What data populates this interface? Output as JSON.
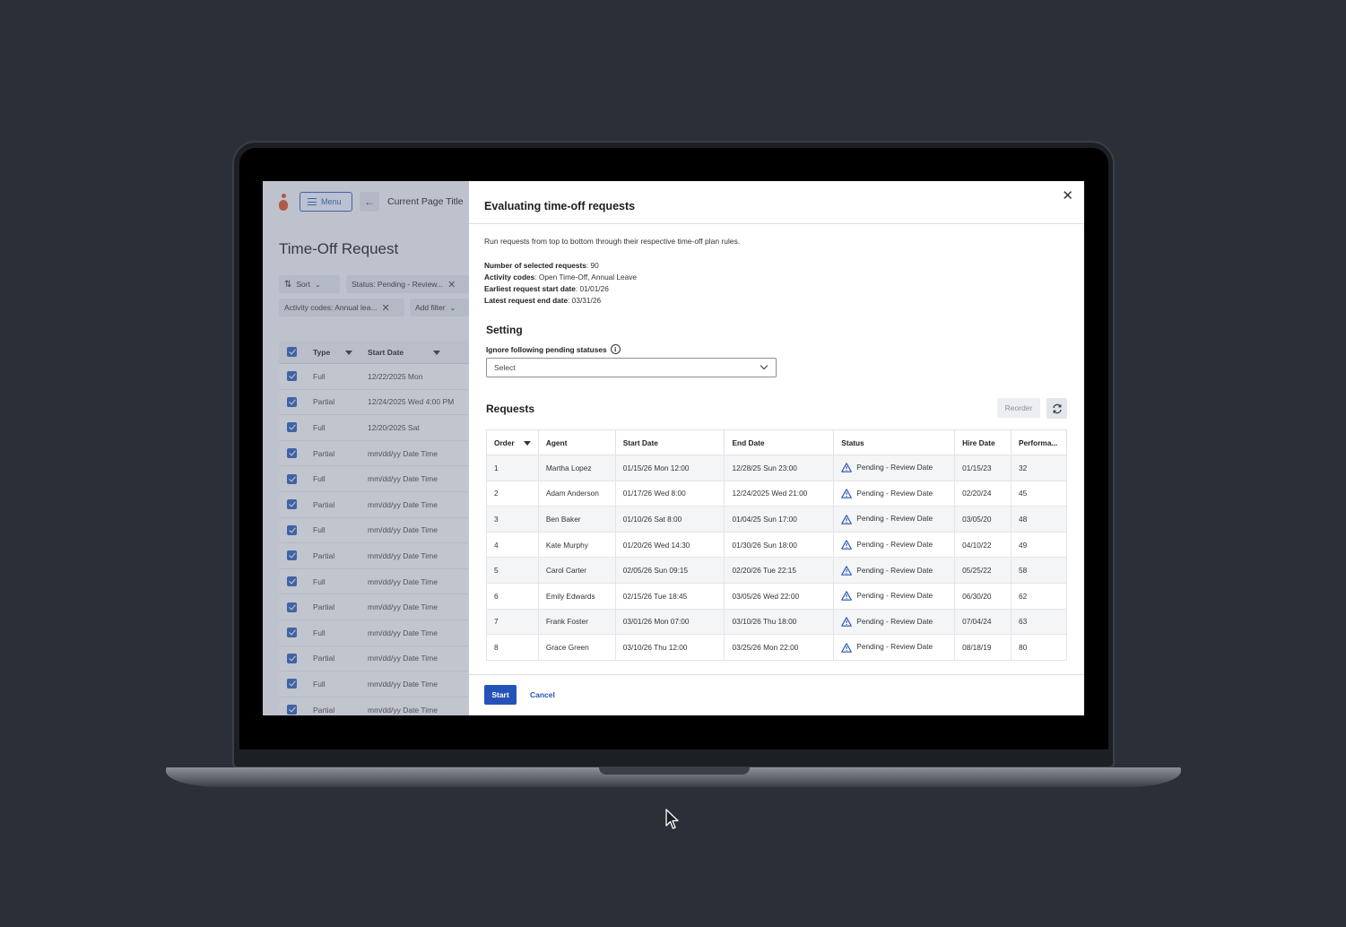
{
  "bg_app": {
    "menu_label": "Menu",
    "page_title": "Current Page Title",
    "heading": "Time-Off Request",
    "filters": {
      "sort": "Sort",
      "status": "Status: Pending - Review...",
      "activity": "Activity codes: Annual lea...",
      "add": "Add filter"
    },
    "table": {
      "col_type": "Type",
      "col_start": "Start Date",
      "rows": [
        {
          "type": "Full",
          "start": "12/22/2025 Mon"
        },
        {
          "type": "Partial",
          "start": "12/24/2025 Wed 4:00 PM"
        },
        {
          "type": "Full",
          "start": "12/20/2025 Sat"
        },
        {
          "type": "Partial",
          "start": "mm/dd/yy Date Time"
        },
        {
          "type": "Full",
          "start": "mm/dd/yy Date Time"
        },
        {
          "type": "Partial",
          "start": "mm/dd/yy Date Time"
        },
        {
          "type": "Full",
          "start": "mm/dd/yy Date Time"
        },
        {
          "type": "Partial",
          "start": "mm/dd/yy Date Time"
        },
        {
          "type": "Full",
          "start": "mm/dd/yy Date Time"
        },
        {
          "type": "Partial",
          "start": "mm/dd/yy Date Time"
        },
        {
          "type": "Full",
          "start": "mm/dd/yy Date Time"
        },
        {
          "type": "Partial",
          "start": "mm/dd/yy Date Time"
        },
        {
          "type": "Full",
          "start": "mm/dd/yy Date Time"
        },
        {
          "type": "Partial",
          "start": "mm/dd/yy Date Time"
        }
      ]
    }
  },
  "modal": {
    "title": "Evaluating time-off requests",
    "intro": "Run requests from top to bottom through their respective time-off plan rules.",
    "info": [
      {
        "label": "Number of selected requests",
        "value": "90"
      },
      {
        "label": "Activity codes",
        "value": "Open Time-Off, Annual Leave"
      },
      {
        "label": "Earliest request start date",
        "value": "01/01/26"
      },
      {
        "label": "Latest request end date",
        "value": "03/31/26"
      }
    ],
    "setting_heading": "Setting",
    "ignore_label": "Ignore following pending statuses",
    "select_placeholder": "Select",
    "requests_heading": "Requests",
    "reorder_label": "Reorder",
    "columns": [
      "Order",
      "Agent",
      "Start Date",
      "End Date",
      "Status",
      "Hire Date",
      "Performa..."
    ],
    "rows": [
      {
        "order": "1",
        "agent": "Martha Lopez",
        "start": "01/15/26 Mon 12:00",
        "end": "12/28/25 Sun 23:00",
        "status": "Pending - Review Date",
        "hire": "01/15/23",
        "perf": "32"
      },
      {
        "order": "2",
        "agent": "Adam Anderson",
        "start": "01/17/26 Wed 8:00",
        "end": "12/24/2025 Wed 21:00",
        "status": "Pending - Review Date",
        "hire": "02/20/24",
        "perf": "45"
      },
      {
        "order": "3",
        "agent": "Ben Baker",
        "start": "01/10/26 Sat 8:00",
        "end": "01/04/25 Sun 17:00",
        "status": "Pending - Review Date",
        "hire": "03/05/20",
        "perf": "48"
      },
      {
        "order": "4",
        "agent": "Kate Murphy",
        "start": "01/20/26 Wed 14:30",
        "end": "01/30/26 Sun 18:00",
        "status": "Pending - Review Date",
        "hire": "04/10/22",
        "perf": "49"
      },
      {
        "order": "5",
        "agent": "Carol Carter",
        "start": "02/05/26 Sun 09:15",
        "end": "02/20/26 Tue 22:15",
        "status": "Pending - Review Date",
        "hire": "05/25/22",
        "perf": "58"
      },
      {
        "order": "6",
        "agent": "Emily Edwards",
        "start": "02/15/26 Tue 18:45",
        "end": "03/05/26 Wed 22:00",
        "status": "Pending - Review Date",
        "hire": "06/30/20",
        "perf": "62"
      },
      {
        "order": "7",
        "agent": "Frank Foster",
        "start": "03/01/26 Mon 07:00",
        "end": "03/10/26 Thu 18:00",
        "status": "Pending - Review Date",
        "hire": "07/04/24",
        "perf": "63"
      },
      {
        "order": "8",
        "agent": "Grace Green",
        "start": "03/10/26 Thu 12:00",
        "end": "03/25/26 Mon 22:00",
        "status": "Pending - Review Date",
        "hire": "08/18/19",
        "perf": "80"
      }
    ],
    "start_label": "Start",
    "cancel_label": "Cancel"
  },
  "colors": {
    "accent": "#2453b8",
    "logo": "#d9512c",
    "background": "#2b2f38"
  },
  "icons": {
    "close": "close-icon",
    "refresh": "refresh-icon",
    "warning": "warning-icon",
    "info": "info-icon",
    "back": "arrow-left-icon"
  }
}
